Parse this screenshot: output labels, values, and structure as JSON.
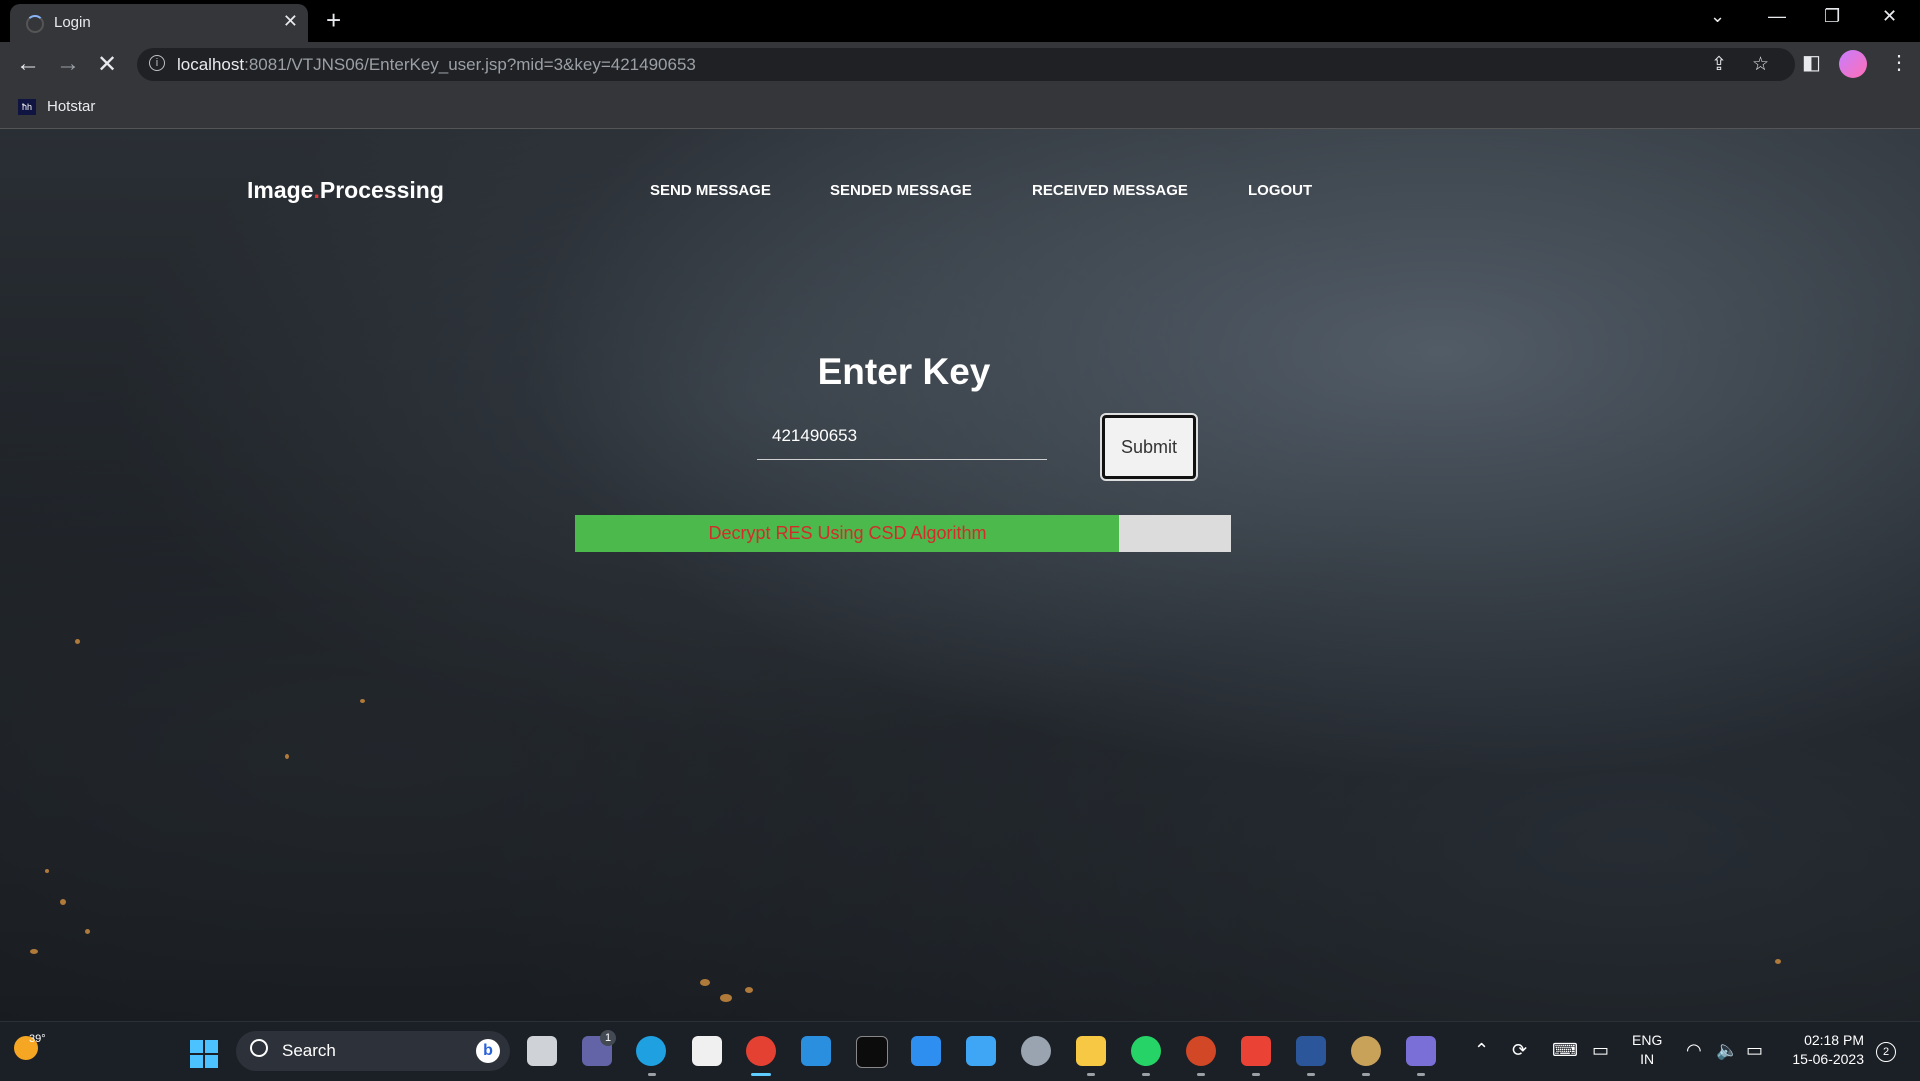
{
  "browser": {
    "tab_title": "Login",
    "url_host": "localhost",
    "url_rest": ":8081/VTJNS06/EnterKey_user.jsp?mid=3&key=421490653",
    "bookmarks": [
      {
        "label": "Hotstar",
        "favicon_text": "ћh"
      }
    ]
  },
  "site": {
    "brand_part1": "Image",
    "brand_dot": ".",
    "brand_part2": "Processing",
    "nav": [
      {
        "label": "SEND MESSAGE"
      },
      {
        "label": "SENDED MESSAGE"
      },
      {
        "label": "RECEIVED MESSAGE"
      },
      {
        "label": "LOGOUT"
      }
    ]
  },
  "main": {
    "heading": "Enter Key",
    "key_value": "421490653",
    "submit_label": "Submit",
    "progress_label": "Decrypt RES Using CSD Algorithm",
    "progress_fraction": 0.83
  },
  "taskbar": {
    "temperature": "39°",
    "search_placeholder": "Search",
    "teams_badge": "1",
    "language_line1": "ENG",
    "language_line2": "IN",
    "time": "02:18 PM",
    "date": "15-06-2023",
    "notification_count": "2"
  },
  "colors": {
    "progress_fill": "#4cb94c",
    "progress_track": "#dcdcdc",
    "progress_text": "#d42b2b",
    "brand_dot": "#e03a3a"
  }
}
